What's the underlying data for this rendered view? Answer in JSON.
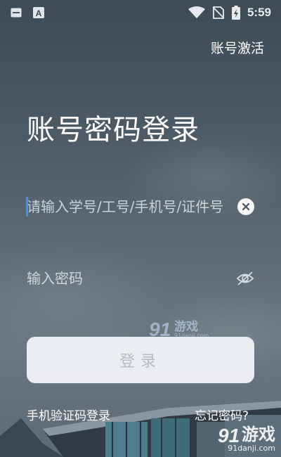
{
  "status_bar": {
    "time": "5:59",
    "left_icons": [
      "app-notification-icon",
      "font-app-icon"
    ],
    "right_icons": [
      "wifi-icon",
      "no-sim-icon",
      "battery-charging-icon"
    ]
  },
  "header": {
    "activate_label": "账号激活"
  },
  "page_title": "账号密码登录",
  "form": {
    "account_placeholder": "请输入学号/工号/手机号/证件号",
    "password_placeholder": "输入密码",
    "login_label": "登录"
  },
  "footer": {
    "sms_login": "手机验证码登录",
    "forgot_password": "忘记密码?"
  },
  "watermark": {
    "brand_center": "游戏",
    "url_center": "91danji.com",
    "brand_corner": "游戏",
    "url_corner": "91danji.com"
  },
  "colors": {
    "accent_caret": "#4a8cf0",
    "button_bg": "#f0f2f5",
    "button_text": "#b6bcc3"
  }
}
